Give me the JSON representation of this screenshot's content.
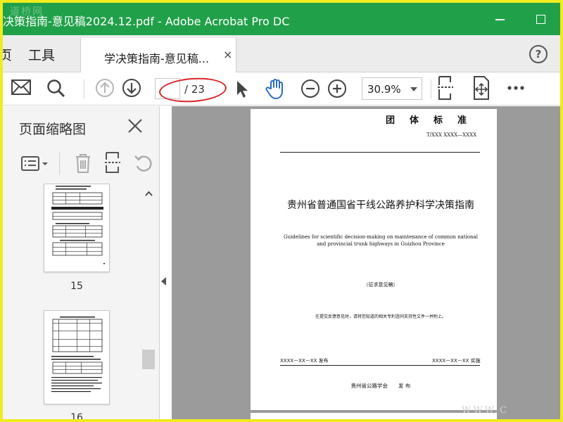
{
  "window": {
    "title": "决策指南-意见稿2024.12.pdf - Adobe Acrobat Pro DC",
    "watermark": "道桥网"
  },
  "tabs": {
    "home": "页",
    "tools": "工具",
    "document": "学决策指南-意见稿...",
    "close": "×",
    "help": "?"
  },
  "toolbar": {
    "current_page": "",
    "total_pages": "/ 23",
    "zoom": "30.9%",
    "icons": [
      "mail-icon",
      "search-icon",
      "prev-page-icon",
      "next-page-icon",
      "select-arrow-icon",
      "hand-icon",
      "zoom-out-icon",
      "zoom-in-icon",
      "scroll-mode-icon",
      "fit-page-icon",
      "more-icon"
    ],
    "accent_color": "#2b6cc4",
    "annotation_color": "#d8262b"
  },
  "sidebar": {
    "title": "页面缩略图",
    "thumbnails": [
      {
        "page": "15"
      },
      {
        "page": "16"
      }
    ]
  },
  "document_page": {
    "header": "团体标准",
    "code": "T/XXX XXXX—XXXX",
    "title_cn": "贵州省普通国省干线公路养护科学决策指南",
    "title_en": "Guidelines for scientific decision-making on maintenance of common national and provincial trunk highways in Guizhou Province",
    "draft_label": "（征求意见稿）",
    "note": "在提交反馈意见时，请将您知道的相关专利连同支持性文件一并附上。",
    "issue_date": "XXXX－XX－XX 发布",
    "impl_date": "XXXX－XX－XX 实施",
    "publisher": "贵州省公路学会　　发 布"
  },
  "watermark_url": "WWW.C"
}
